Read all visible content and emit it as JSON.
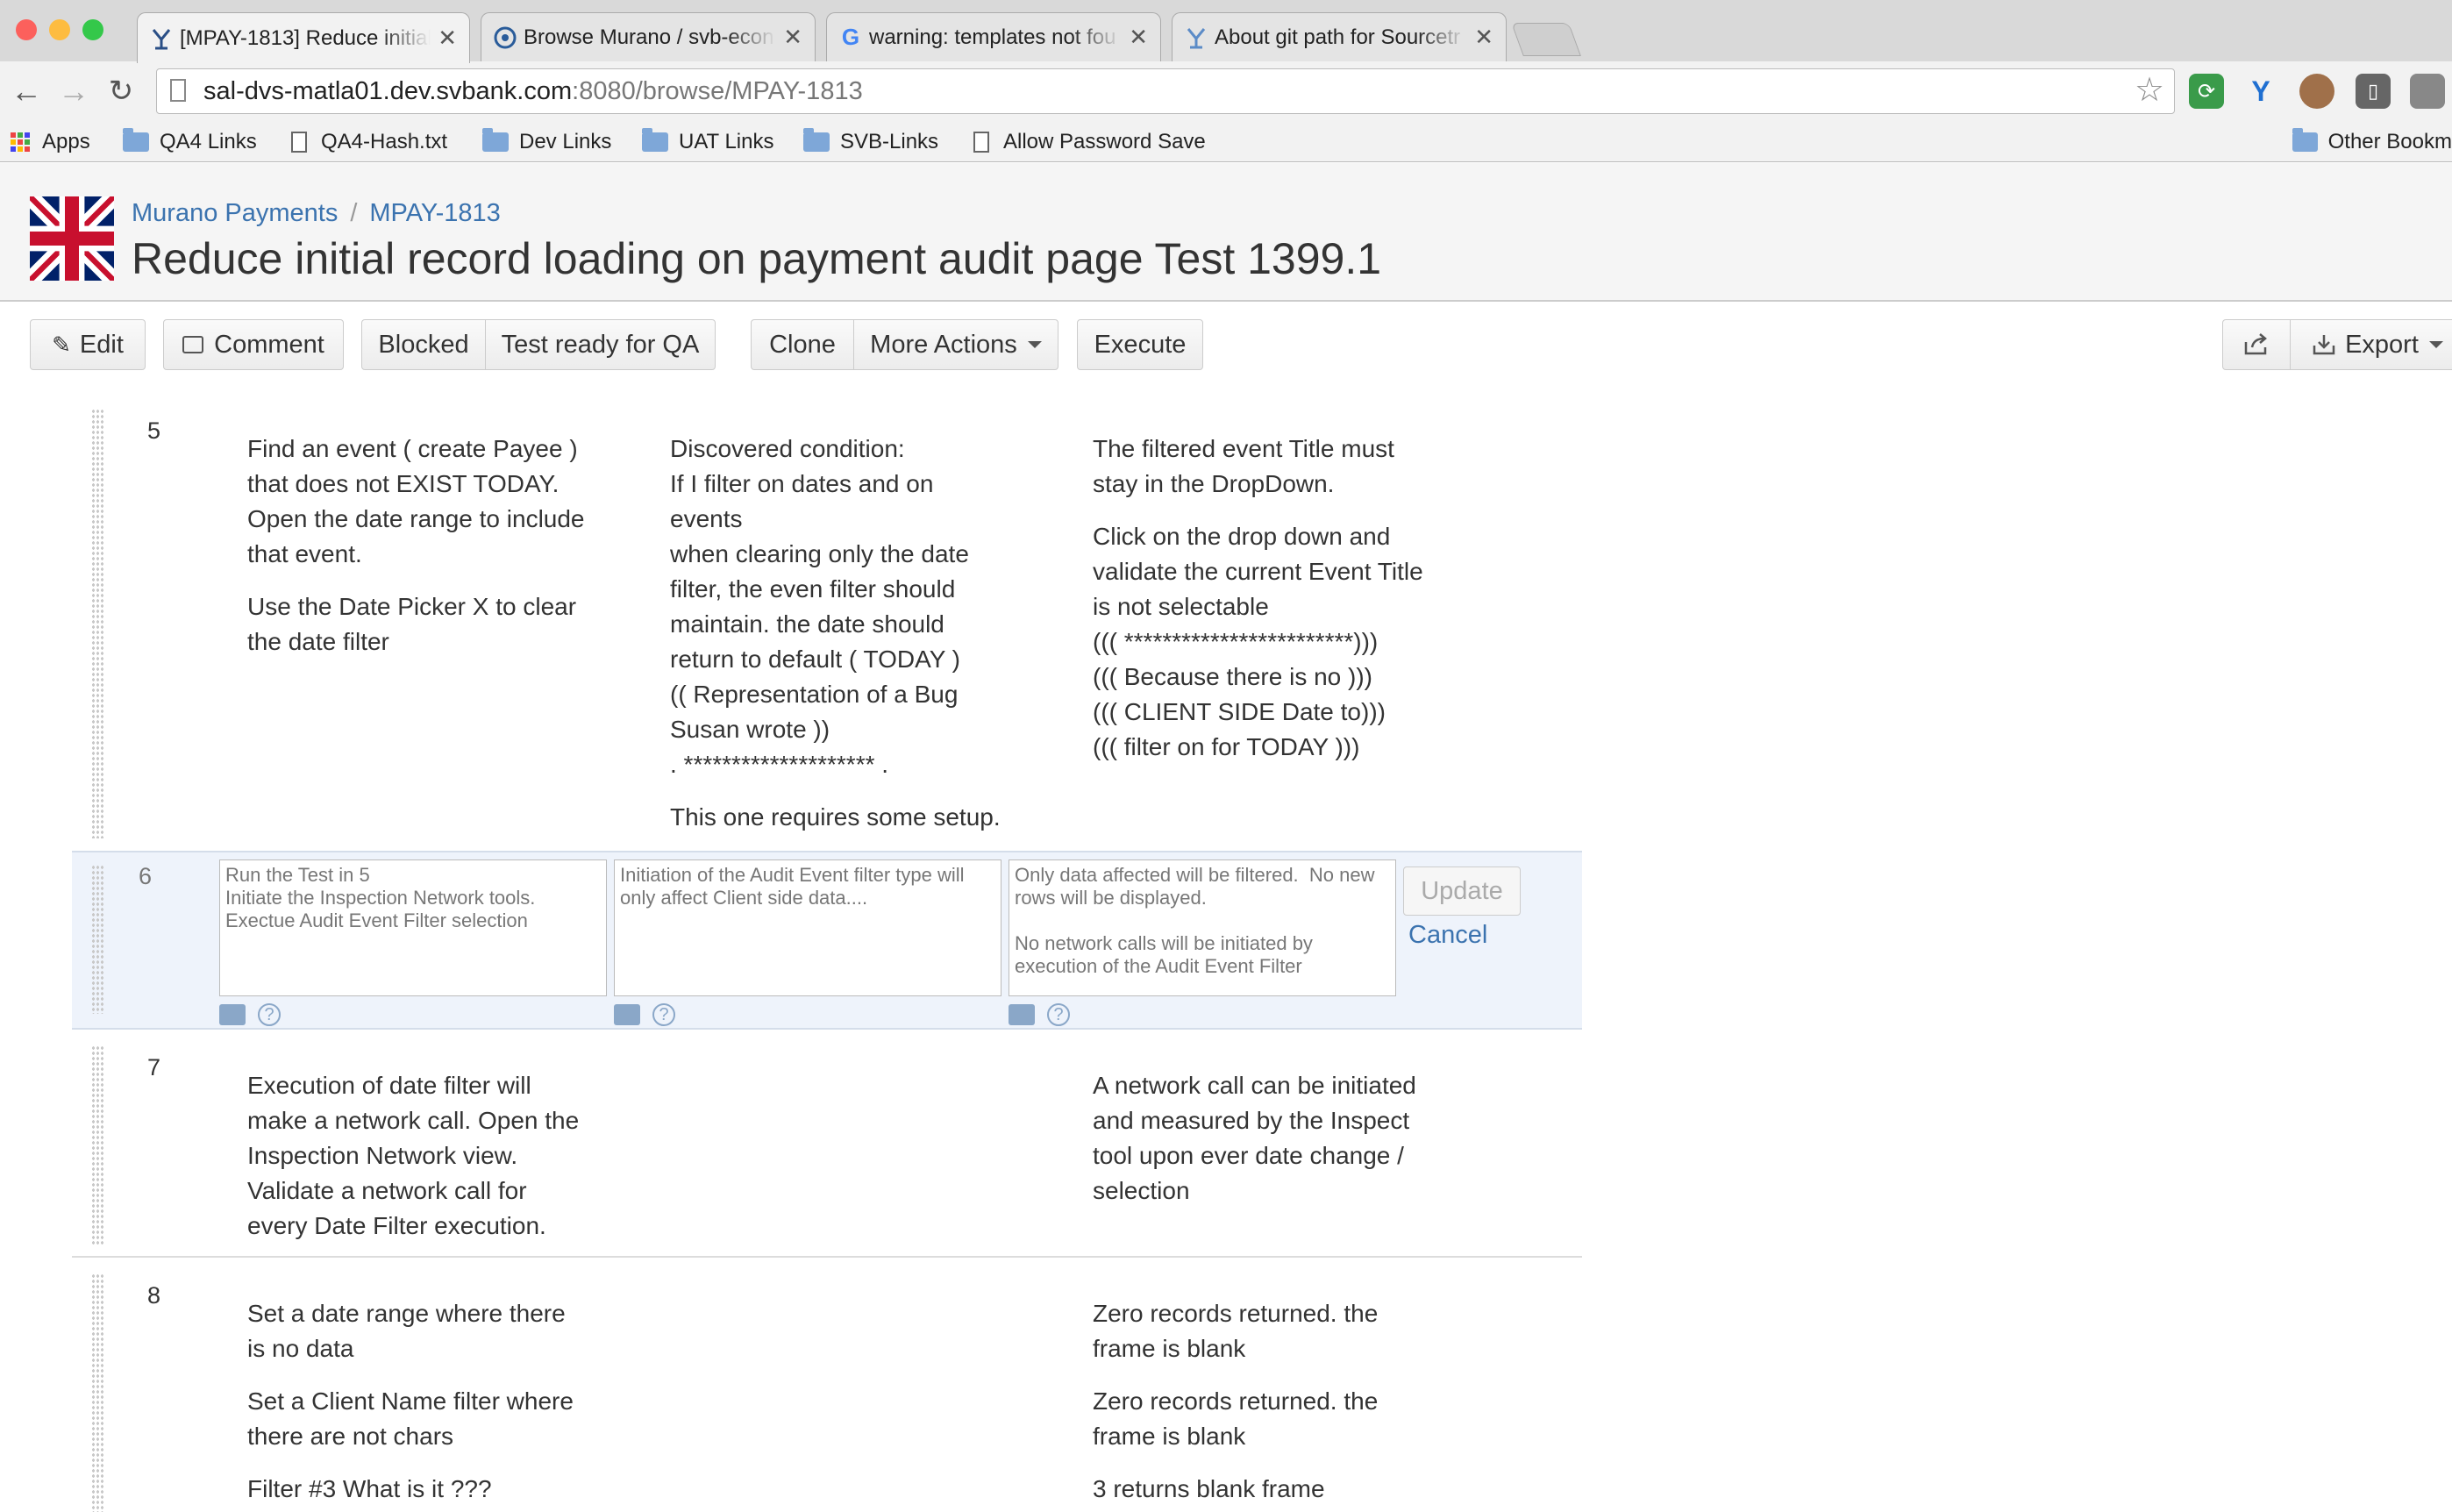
{
  "browser": {
    "tabs": [
      {
        "title": "[MPAY-1813] Reduce initial",
        "icon": "jira-icon",
        "active": true
      },
      {
        "title": "Browse Murano / svb-econ",
        "icon": "bitbucket-icon",
        "active": false
      },
      {
        "title": "warning: templates not fou",
        "icon": "google-icon",
        "active": false
      },
      {
        "title": "About git path for Sourcetr",
        "icon": "jira-icon",
        "active": false
      }
    ],
    "url_host": "sal-dvs-matla01.dev.svbank.com",
    "url_rest": ":8080/browse/MPAY-1813",
    "bookmarks": [
      {
        "label": "Apps",
        "type": "apps"
      },
      {
        "label": "QA4 Links",
        "type": "folder"
      },
      {
        "label": "QA4-Hash.txt",
        "type": "page"
      },
      {
        "label": "Dev Links",
        "type": "folder"
      },
      {
        "label": "UAT Links",
        "type": "folder"
      },
      {
        "label": "SVB-Links",
        "type": "folder"
      },
      {
        "label": "Allow Password Save",
        "type": "page"
      }
    ],
    "other_bookmarks": "Other Bookm"
  },
  "issue": {
    "project": "Murano Payments",
    "key": "MPAY-1813",
    "title": "Reduce initial record loading on payment audit page Test 1399.1"
  },
  "actions": {
    "edit": "Edit",
    "comment": "Comment",
    "blocked": "Blocked",
    "test_ready": "Test ready for QA",
    "clone": "Clone",
    "more_actions": "More Actions",
    "execute": "Execute",
    "export": "Export"
  },
  "steps": {
    "s5": {
      "num": "5",
      "step": [
        "Find an event ( create Payee )",
        "that does not EXIST TODAY.",
        "Open the date range to include",
        "that event.",
        "",
        "Use the Date Picker X to clear",
        "the date filter"
      ],
      "data": [
        "Discovered condition:",
        "If I filter on dates and on",
        "events",
        "when clearing only the date",
        "filter, the even filter should",
        "maintain. the date should",
        "return to default ( TODAY )",
        "(( Representation of a Bug",
        "Susan wrote ))",
        ". ******************** .",
        "",
        "This one requires some setup."
      ],
      "result": [
        "The filtered event Title must",
        "stay in the DropDown.",
        "",
        "Click on the drop down and",
        "validate the current Event Title",
        "is not selectable",
        "((( ************************)))",
        "((( Because there is no )))",
        "((( CLIENT SIDE Date to)))",
        "((( filter on for TODAY )))"
      ]
    },
    "s6": {
      "num": "6",
      "step": "Run the Test in 5\nInitiate the Inspection Network tools.\nExectue Audit Event Filter selection",
      "data": "Initiation of the Audit Event filter type will only affect Client side data....",
      "result": "Only data affected will be filtered.  No new rows will be displayed.\n\nNo network calls will be initiated by execution of the Audit Event Filter",
      "update": "Update",
      "cancel": "Cancel"
    },
    "s7": {
      "num": "7",
      "step": [
        "Execution of date filter will",
        "make a network call. Open the",
        "Inspection Network view.",
        "Validate a network call for",
        "every Date Filter execution."
      ],
      "result": [
        "A network call can be initiated",
        "and measured by the Inspect",
        "tool upon ever date change /",
        "selection"
      ]
    },
    "s8": {
      "num": "8",
      "step": [
        "Set a date range where there",
        "is no data",
        "",
        "Set a Client Name filter where",
        "there are not chars",
        "",
        "Filter #3 What is it ???"
      ],
      "result": [
        "Zero records returned. the",
        "frame is blank",
        "",
        "Zero records returned. the",
        "frame is blank",
        "",
        "3 returns blank frame"
      ]
    }
  }
}
